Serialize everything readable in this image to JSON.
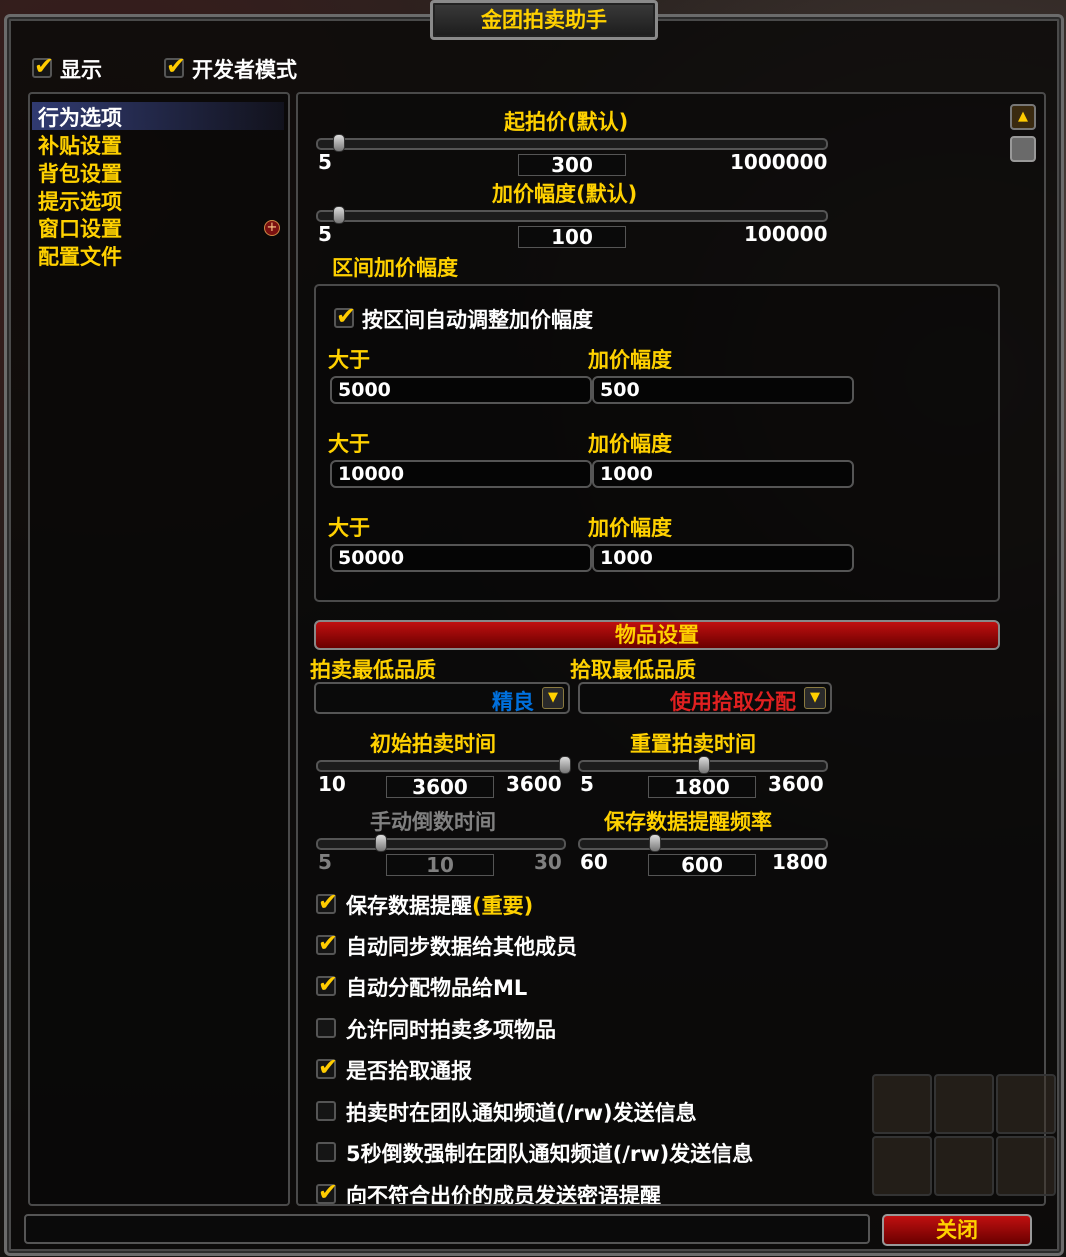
{
  "window": {
    "title": "金团拍卖助手"
  },
  "top_checks": {
    "show": {
      "label": "显示",
      "checked": true
    },
    "dev_mode": {
      "label": "开发者模式",
      "checked": true
    }
  },
  "nav": {
    "items": [
      {
        "label": "行为选项",
        "selected": true
      },
      {
        "label": "补贴设置"
      },
      {
        "label": "背包设置"
      },
      {
        "label": "提示选项"
      },
      {
        "label": "窗口设置"
      },
      {
        "label": "配置文件"
      }
    ],
    "expand_icon": "plus-icon"
  },
  "start_price": {
    "title": "起拍价(默认)",
    "min": "5",
    "max": "1000000",
    "value": "300",
    "fraction": 0.04
  },
  "increment": {
    "title": "加价幅度(默认)",
    "min": "5",
    "max": "100000",
    "value": "100",
    "fraction": 0.04
  },
  "range_section": {
    "title": "区间加价幅度",
    "auto_adjust": {
      "label": "按区间自动调整加价幅度",
      "checked": true
    },
    "rows": [
      {
        "gt_label": "大于",
        "gt_value": "5000",
        "inc_label": "加价幅度",
        "inc_value": "500"
      },
      {
        "gt_label": "大于",
        "gt_value": "10000",
        "inc_label": "加价幅度",
        "inc_value": "1000"
      },
      {
        "gt_label": "大于",
        "gt_value": "50000",
        "inc_label": "加价幅度",
        "inc_value": "1000"
      }
    ]
  },
  "items_header": "物品设置",
  "min_quality": {
    "label": "拍卖最低品质",
    "value": "精良",
    "value_color": "#0070dd"
  },
  "loot_quality": {
    "label": "拾取最低品质",
    "value": "使用拾取分配",
    "value_color": "#e02020"
  },
  "initial_time": {
    "title": "初始拍卖时间",
    "min": "10",
    "max": "3600",
    "value": "3600",
    "fraction": 1.0
  },
  "reset_time": {
    "title": "重置拍卖时间",
    "min": "5",
    "max": "3600",
    "value": "1800",
    "fraction": 0.5
  },
  "manual_countdown": {
    "title": "手动倒数时间",
    "min": "5",
    "max": "30",
    "value": "10",
    "fraction": 0.25,
    "disabled": true
  },
  "save_reminder_freq": {
    "title": "保存数据提醒频率",
    "min": "60",
    "max": "1800",
    "value": "600",
    "fraction": 0.3
  },
  "options": [
    {
      "label": "保存数据提醒",
      "suffix": "(重要)",
      "checked": true
    },
    {
      "label": "自动同步数据给其他成员",
      "checked": true
    },
    {
      "label": "自动分配物品给ML",
      "checked": true
    },
    {
      "label": "允许同时拍卖多项物品",
      "checked": false
    },
    {
      "label": "是否拾取通报",
      "checked": true
    },
    {
      "label": "拍卖时在团队通知频道(/rw)发送信息",
      "checked": false
    },
    {
      "label": "5秒倒数强制在团队通知频道(/rw)发送信息",
      "checked": false
    },
    {
      "label": "向不符合出价的成员发送密语提醒",
      "checked": true
    }
  ],
  "footer": {
    "close_label": "关闭"
  },
  "colors": {
    "gold": "#ffd100",
    "white": "#ffffff",
    "red_bar": "#b00000",
    "disabled": "#808080"
  }
}
